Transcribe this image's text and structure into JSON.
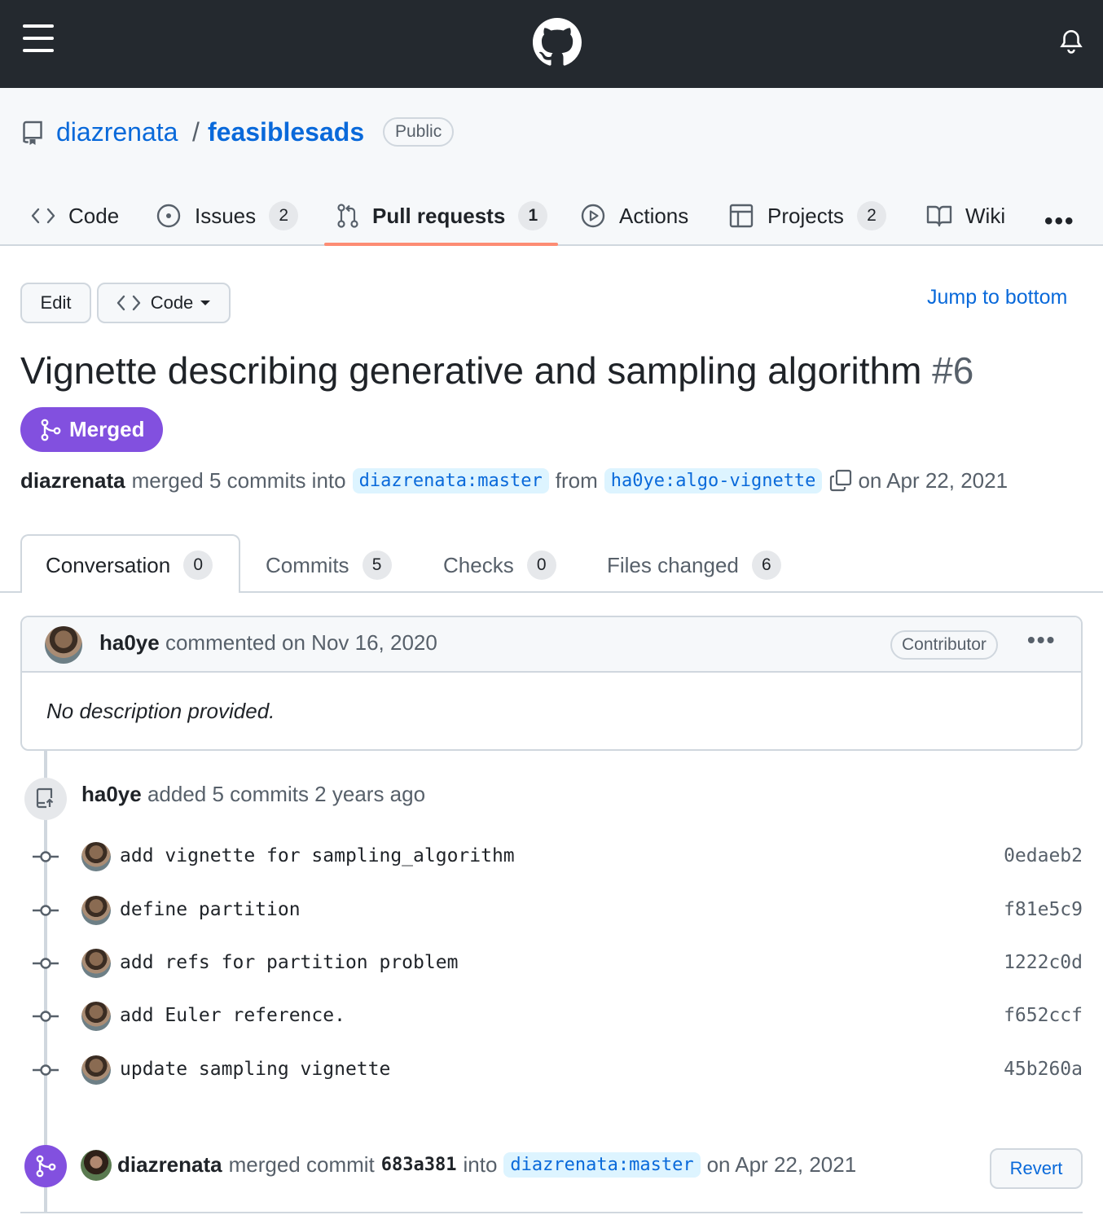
{
  "header": {
    "menu_icon": "hamburger-icon",
    "logo_icon": "github-logo-icon",
    "notifications_icon": "bell-icon"
  },
  "repo": {
    "owner": "diazrenata",
    "separator": "/",
    "name": "feasiblesads",
    "visibility": "Public"
  },
  "nav": {
    "items": [
      {
        "label": "Code",
        "icon": "code-icon",
        "count": ""
      },
      {
        "label": "Issues",
        "icon": "issue-opened-icon",
        "count": "2"
      },
      {
        "label": "Pull requests",
        "icon": "git-pull-request-icon",
        "count": "1",
        "active": true
      },
      {
        "label": "Actions",
        "icon": "play-icon",
        "count": ""
      },
      {
        "label": "Projects",
        "icon": "table-icon",
        "count": "2"
      },
      {
        "label": "Wiki",
        "icon": "book-icon",
        "count": ""
      }
    ],
    "more": "•••"
  },
  "actions": {
    "edit": "Edit",
    "code": "Code",
    "jump": "Jump to bottom"
  },
  "pr": {
    "title": "Vignette describing generative and sampling algorithm",
    "number": "#6",
    "state": "Merged",
    "merger": "diazrenata",
    "merged_text": "merged 5 commits into",
    "base_branch": "diazrenata:master",
    "from_text": "from",
    "head_branch": "ha0ye:algo-vignette",
    "date_text": "on Apr 22, 2021"
  },
  "tabs": [
    {
      "label": "Conversation",
      "count": "0",
      "active": true
    },
    {
      "label": "Commits",
      "count": "5"
    },
    {
      "label": "Checks",
      "count": "0"
    },
    {
      "label": "Files changed",
      "count": "6"
    }
  ],
  "comment": {
    "author": "ha0ye",
    "action": "commented on Nov 16, 2020",
    "role": "Contributor",
    "menu": "•••",
    "body": "No description provided."
  },
  "timeline": {
    "added_author": "ha0ye",
    "added_text": "added 5 commits 2 years ago",
    "commits": [
      {
        "message": "add vignette for sampling_algorithm",
        "sha": "0edaeb2"
      },
      {
        "message": "define partition",
        "sha": "f81e5c9"
      },
      {
        "message": "add refs for partition problem",
        "sha": "1222c0d"
      },
      {
        "message": "add Euler reference.",
        "sha": "f652ccf"
      },
      {
        "message": "update sampling vignette",
        "sha": "45b260a"
      }
    ],
    "merge": {
      "author": "diazrenata",
      "text": "merged commit",
      "sha": "683a381",
      "into": "into",
      "branch": "diazrenata:master",
      "date": "on Apr 22, 2021",
      "revert": "Revert"
    }
  },
  "colors": {
    "header_bg": "#24292f",
    "link": "#0969da",
    "merged": "#8250df",
    "active_tab_underline": "#fd8c73",
    "branch_bg": "#ddf4ff"
  }
}
